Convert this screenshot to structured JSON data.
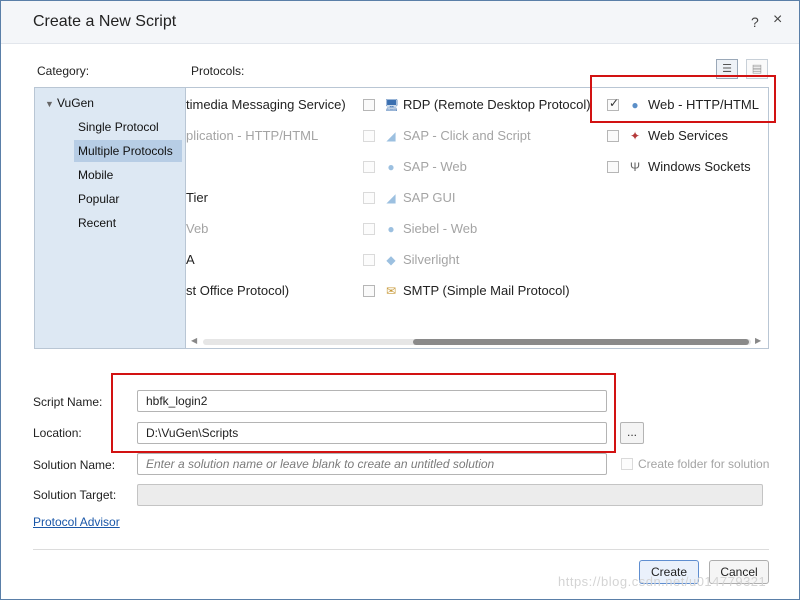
{
  "window": {
    "title": "Create a New Script",
    "help_label": "?",
    "close_label": "×"
  },
  "labels": {
    "category": "Category:",
    "protocols": "Protocols:"
  },
  "categories": {
    "root": "VuGen",
    "items": [
      {
        "label": "Single Protocol"
      },
      {
        "label": "Multiple Protocols",
        "selected": true
      },
      {
        "label": "Mobile"
      },
      {
        "label": "Popular"
      },
      {
        "label": "Recent"
      }
    ]
  },
  "protocols": {
    "col1": [
      {
        "label": "timedia Messaging Service)",
        "disabled": false
      },
      {
        "label": "plication - HTTP/HTML",
        "disabled": true
      },
      {
        "label": "",
        "disabled": false
      },
      {
        "label": " Tier",
        "disabled": false
      },
      {
        "label": "Veb",
        "disabled": true
      },
      {
        "label": "A",
        "disabled": false
      },
      {
        "label": "st Office Protocol)",
        "disabled": false
      }
    ],
    "col2": [
      {
        "label": "RDP (Remote Desktop Protocol)",
        "disabled": false,
        "icon": "monitor-icon"
      },
      {
        "label": "SAP - Click and Script",
        "disabled": true,
        "icon": "sap-icon"
      },
      {
        "label": "SAP - Web",
        "disabled": true,
        "icon": "globe-icon"
      },
      {
        "label": "SAP GUI",
        "disabled": true,
        "icon": "sap-icon"
      },
      {
        "label": "Siebel - Web",
        "disabled": true,
        "icon": "globe-icon"
      },
      {
        "label": "Silverlight",
        "disabled": true,
        "icon": "silverlight-icon"
      },
      {
        "label": "SMTP (Simple Mail Protocol)",
        "disabled": false,
        "icon": "mail-icon"
      }
    ],
    "col3": [
      {
        "label": "Web - HTTP/HTML",
        "checked": true,
        "icon": "globe-icon"
      },
      {
        "label": "Web Services",
        "checked": false,
        "icon": "web-services-icon"
      },
      {
        "label": "Windows Sockets",
        "checked": false,
        "icon": "socket-icon"
      }
    ]
  },
  "form": {
    "script_name_label": "Script Name:",
    "script_name_value": "hbfk_login2",
    "location_label": "Location:",
    "location_value": "D:\\VuGen\\Scripts",
    "browse_label": "...",
    "solution_name_label": "Solution Name:",
    "solution_name_placeholder": "Enter a solution name or leave blank to create an untitled solution",
    "create_folder_label": "Create folder for solution",
    "solution_target_label": "Solution Target:",
    "solution_target_value": "",
    "protocol_advisor_link": "Protocol Advisor"
  },
  "buttons": {
    "create": "Create",
    "cancel": "Cancel"
  },
  "watermark": "https://blog.csdn.net/u014779321",
  "colors": {
    "highlight_box": "#d21212",
    "link": "#1a57a8",
    "selected_category": "#b7cde5",
    "category_background": "#dde8f3"
  }
}
